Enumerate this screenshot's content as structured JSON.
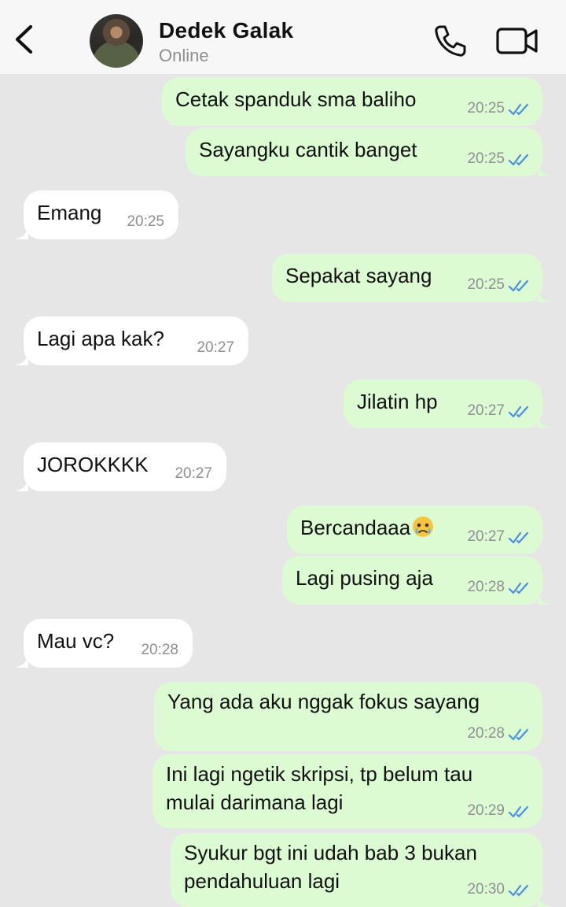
{
  "header": {
    "contact_name": "Dedek Galak",
    "status": "Online",
    "icons": [
      "back-arrow-icon",
      "phone-icon",
      "video-camera-icon"
    ]
  },
  "colors": {
    "background": "#e6e6e6",
    "header": "#f7f7f7",
    "incoming_bubble": "#ffffff",
    "outgoing_bubble": "#dcfbd2",
    "read_ticks": "#4a90e2"
  },
  "messages": [
    {
      "dir": "out",
      "text": "Cetak spanduk sma baliho",
      "time": "20:25",
      "status": "read"
    },
    {
      "dir": "out",
      "text": "Sayangku cantik banget",
      "time": "20:25",
      "status": "read"
    },
    {
      "dir": "in",
      "text": "Emang",
      "time": "20:25"
    },
    {
      "dir": "out",
      "text": "Sepakat sayang",
      "time": "20:25",
      "status": "read"
    },
    {
      "dir": "in",
      "text": "Lagi apa kak?",
      "time": "20:27"
    },
    {
      "dir": "out",
      "text": "Jilatin hp",
      "time": "20:27",
      "status": "read"
    },
    {
      "dir": "in",
      "text": "JOROKKKK",
      "time": "20:27"
    },
    {
      "dir": "out",
      "text": "Bercandaaa",
      "emoji": "face-holding-back-tears-emoji",
      "time": "20:27",
      "status": "read"
    },
    {
      "dir": "out",
      "text": "Lagi pusing aja",
      "time": "20:28",
      "status": "read"
    },
    {
      "dir": "in",
      "text": "Mau vc?",
      "time": "20:28"
    },
    {
      "dir": "out",
      "text": "Yang ada aku nggak fokus sayang",
      "time": "20:28",
      "status": "read"
    },
    {
      "dir": "out",
      "lines": [
        "Ini lagi ngetik skripsi, tp belum tau",
        "mulai darimana lagi"
      ],
      "time": "20:29",
      "status": "read"
    },
    {
      "dir": "out",
      "lines": [
        "Syukur bgt ini udah bab 3 bukan",
        "pendahuluan lagi"
      ],
      "time": "20:30",
      "status": "read"
    }
  ]
}
